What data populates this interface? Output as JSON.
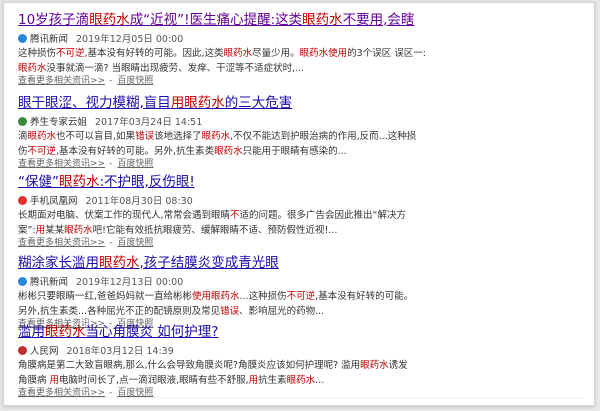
{
  "results": [
    {
      "title": [
        {
          "t": "10岁孩子滴"
        },
        {
          "t": "眼药水",
          "hl": true
        },
        {
          "t": "成“近视”!医生痛心提醒:这类"
        },
        {
          "t": "眼药水",
          "hl": true
        },
        {
          "t": "不要用,会瞎"
        }
      ],
      "visited": true,
      "source": "腾讯新闻",
      "date": "2019年12月05日 00:00",
      "snippet": [
        [
          {
            "t": "这种损伤"
          },
          {
            "t": "不可逆",
            "hl": true
          },
          {
            "t": ",基本没有好转的可能。因此,这类"
          },
          {
            "t": "眼药水",
            "hl": true
          },
          {
            "t": "尽量少用。"
          },
          {
            "t": "眼药水使用",
            "hl": true
          },
          {
            "t": "的3个误区 误区一:"
          }
        ],
        [
          {
            "t": "眼药水",
            "hl": true
          },
          {
            "t": "没事就滴一滴? 当眼睛出现疲劳、发痒、干涩等不适症状时,..."
          }
        ]
      ],
      "links": [
        "查看更多相关资讯>>",
        "百度快照"
      ]
    },
    {
      "title": [
        {
          "t": "眼干眼涩、视力模糊,盲目"
        },
        {
          "t": "用眼药水",
          "hl": true
        },
        {
          "t": "的三大危害"
        }
      ],
      "visited": false,
      "source": "养生专家云姐",
      "date": "2017年03月24日 14:51",
      "snippet": [
        [
          {
            "t": "滴"
          },
          {
            "t": "眼药水",
            "hl": true
          },
          {
            "t": "也不可以盲目,如果"
          },
          {
            "t": "错误",
            "hl": true
          },
          {
            "t": "该地选择了"
          },
          {
            "t": "眼药水",
            "hl": true
          },
          {
            "t": ",不仅不能达到护眼治病的作用,反而...这种损"
          }
        ],
        [
          {
            "t": "伤"
          },
          {
            "t": "不可逆",
            "hl": true
          },
          {
            "t": ",基本没有好转的可能。另外,抗生素类"
          },
          {
            "t": "眼药水",
            "hl": true
          },
          {
            "t": "只能用于眼睛有感染的..."
          }
        ]
      ],
      "links": [
        "查看更多相关资讯>>",
        "百度快照"
      ]
    },
    {
      "title": [
        {
          "t": "“保健”"
        },
        {
          "t": "眼药水",
          "hl": true
        },
        {
          "t": ":不护眼,反伤眼!"
        }
      ],
      "visited": false,
      "source": "手机凤凰网",
      "date": "2011年08月30日 08:30",
      "snippet": [
        [
          {
            "t": "长期面对电脑、伏案工作的现代人,常常会遇到眼睛"
          },
          {
            "t": "不",
            "hl": true
          },
          {
            "t": "适的问题。很多广告会因此推出“解决方"
          }
        ],
        [
          {
            "t": "案”:"
          },
          {
            "t": "用",
            "hl": true
          },
          {
            "t": "某某"
          },
          {
            "t": "眼药水",
            "hl": true
          },
          {
            "t": "吧!它能有效抵抗眼疲劳、缓解眼睛不适、预防假性近视!..."
          }
        ]
      ],
      "links": [
        "查看更多相关资讯>>",
        "百度快照"
      ]
    },
    {
      "title": [
        {
          "t": "糊涂家长滥用"
        },
        {
          "t": "眼药水",
          "hl": true
        },
        {
          "t": ",孩子结膜炎变成青光眼"
        }
      ],
      "visited": false,
      "source": "腾讯新闻",
      "date": "2019年12月13日 00:00",
      "snippet": [
        [
          {
            "t": "彬彬只要眼睛一红,爸爸妈妈就一直给彬彬"
          },
          {
            "t": "使用眼药水",
            "hl": true
          },
          {
            "t": "...这种损伤"
          },
          {
            "t": "不可逆",
            "hl": true
          },
          {
            "t": ",基本没有好转的可能。"
          }
        ],
        [
          {
            "t": "另外,抗生素类...各种屈光不正的配镜原则及常见"
          },
          {
            "t": "错误",
            "hl": true
          },
          {
            "t": "、影响屈光的药物..."
          }
        ]
      ],
      "links": [
        "查看更多相关资讯>>",
        "百度快照"
      ]
    },
    {
      "title": [
        {
          "t": "滥用"
        },
        {
          "t": "眼药水",
          "hl": true
        },
        {
          "t": "当心角膜炎 如何护理?"
        }
      ],
      "visited": false,
      "source": "人民网",
      "date": "2018年03月12日 14:39",
      "snippet": [
        [
          {
            "t": "角膜病是第二大致盲眼病,那么,什么会导致角膜炎呢?角膜炎应该如何护理呢? 滥用"
          },
          {
            "t": "眼药水",
            "hl": true
          },
          {
            "t": "诱发"
          }
        ],
        [
          {
            "t": "角膜病 "
          },
          {
            "t": "用",
            "hl": true
          },
          {
            "t": "电脑时间长了,点一滴润眼液,眼睛有些不舒服,"
          },
          {
            "t": "用",
            "hl": true
          },
          {
            "t": "抗生素"
          },
          {
            "t": "眼药水",
            "hl": true
          },
          {
            "t": "..."
          }
        ]
      ],
      "links": [
        "查看更多相关资讯>>",
        "百度快照"
      ]
    }
  ],
  "colors": {
    "title_link": "#1a0dab",
    "title_visited": "#660099",
    "highlight": "#c00000",
    "meta_text": "#333333",
    "source_icons": [
      "#2a86d8",
      "#3a8a3a",
      "#e03030",
      "#2a86d8",
      "#c03030"
    ]
  },
  "icons": [
    "globe-icon",
    "avatar-icon",
    "phoenix-icon",
    "globe-icon",
    "people-daily-icon"
  ]
}
